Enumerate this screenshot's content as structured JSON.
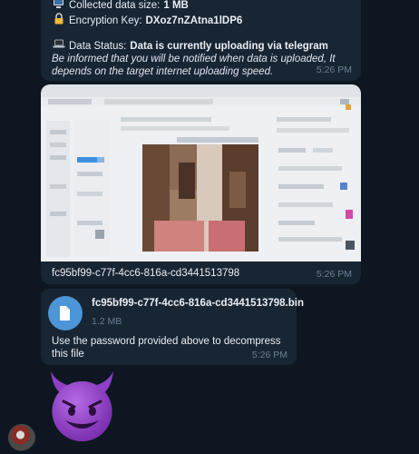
{
  "messages": {
    "info": {
      "collected_label": "Collected data size:",
      "collected_value": "1 MB",
      "key_label": "Encryption Key:",
      "key_value": "DXoz7nZAtna1lDP6",
      "status_label": "Data Status:",
      "status_value": "Data is currently uploading via telegram",
      "note": "Be informed that you will be notified when data is uploaded, It depends on the target internet uploading speed.",
      "time": "5:26 PM",
      "icons": [
        "computer-icon",
        "lock-icon",
        "laptop-icon"
      ]
    },
    "image": {
      "caption": "fc95bf99-c77f-4cc6-816a-cd3441513798",
      "time": "5:26 PM"
    },
    "file": {
      "name": "fc95bf99-c77f-4cc6-816a-cd3441513798.bin",
      "size": "1.2 MB",
      "message": "Use the password provided above to decompress this file",
      "time": "5:26 PM",
      "icon": "document-icon"
    },
    "sticker": {
      "emoji": "smiling-face-with-horns"
    }
  },
  "colors": {
    "background": "#0e1621",
    "bubble": "#182533",
    "timestamp": "#6d7f92",
    "file_icon": "#4c95d7",
    "devil": "#9b4bd1"
  }
}
